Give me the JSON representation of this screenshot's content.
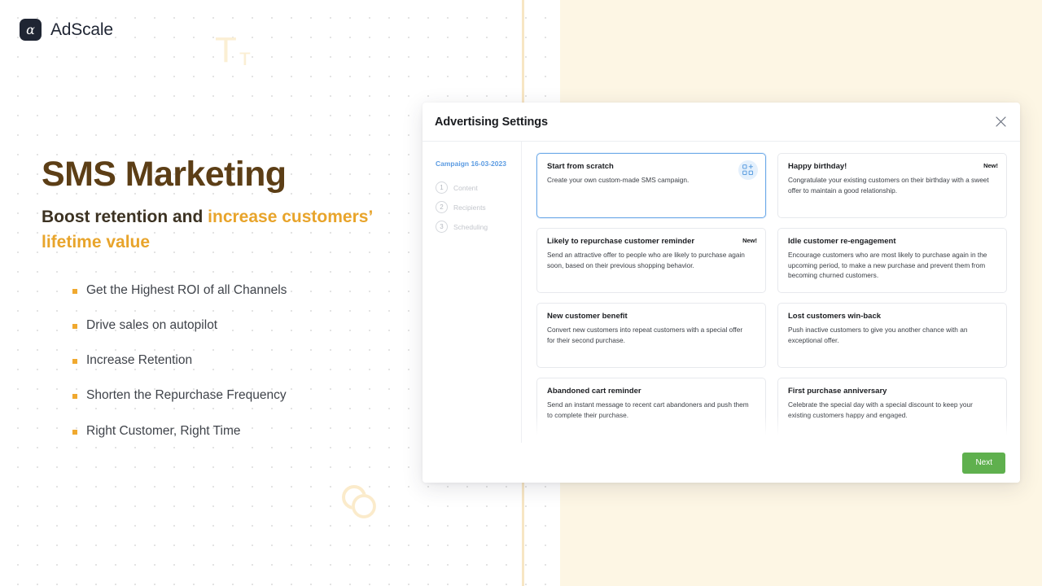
{
  "brand": {
    "logo_glyph": "α",
    "name": "AdScale"
  },
  "hero": {
    "title": "SMS Marketing",
    "subtitle_plain": "Boost retention and ",
    "subtitle_accent": "increase customers’ lifetime value",
    "accent_color": "#E8A42B",
    "title_color": "#5C3E16",
    "bullets": [
      "Get the Highest ROI of all Channels",
      "Drive sales on autopilot",
      "Increase Retention",
      "Shorten the Repurchase Frequency",
      "Right Customer, Right Time"
    ]
  },
  "modal": {
    "title": "Advertising Settings",
    "close_label": "×",
    "sidebar": {
      "campaign_label": "Campaign 16-03-2023",
      "campaign_color": "#5B9BE2",
      "steps": [
        {
          "num": "1",
          "label": "Content"
        },
        {
          "num": "2",
          "label": "Recipients"
        },
        {
          "num": "3",
          "label": "Scheduling"
        }
      ]
    },
    "cards": [
      {
        "title": "Start from scratch",
        "desc": "Create your own custom-made SMS campaign.",
        "selected": true,
        "badge": "",
        "icon": "grid-plus-icon"
      },
      {
        "title": "Happy birthday!",
        "desc": "Congratulate your existing customers on their birthday with a sweet offer to maintain a good relationship.",
        "selected": false,
        "badge": "New!",
        "icon": ""
      },
      {
        "title": "Likely to repurchase customer reminder",
        "desc": "Send an attractive offer to people who are likely to purchase again soon, based on their previous shopping behavior.",
        "selected": false,
        "badge": "New!",
        "icon": ""
      },
      {
        "title": "Idle customer re-engagement",
        "desc": "Encourage customers who are most likely to purchase again in the upcoming period, to make a new purchase and prevent them from becoming churned customers.",
        "selected": false,
        "badge": "",
        "icon": ""
      },
      {
        "title": "New customer benefit",
        "desc": "Convert new customers into repeat customers with a special offer for their second purchase.",
        "selected": false,
        "badge": "",
        "icon": ""
      },
      {
        "title": "Lost customers win-back",
        "desc": "Push inactive customers to give you another chance with an exceptional offer.",
        "selected": false,
        "badge": "",
        "icon": ""
      },
      {
        "title": "Abandoned cart reminder",
        "desc": "Send an instant message to recent cart abandoners and push them to complete their purchase.",
        "selected": false,
        "badge": "",
        "icon": ""
      },
      {
        "title": "First purchase anniversary",
        "desc": "Celebrate the special day with a special discount to keep your existing customers happy and engaged.",
        "selected": false,
        "badge": "",
        "icon": ""
      },
      {
        "title": "",
        "desc": "",
        "selected": false,
        "badge": "",
        "icon": ""
      },
      {
        "title": "",
        "desc": "",
        "selected": false,
        "badge": "",
        "icon": ""
      }
    ],
    "footer": {
      "next_label": "Next",
      "next_color": "#5FB04E"
    }
  },
  "decor": {
    "type_glyph_big": "T",
    "type_glyph_small": "т"
  }
}
